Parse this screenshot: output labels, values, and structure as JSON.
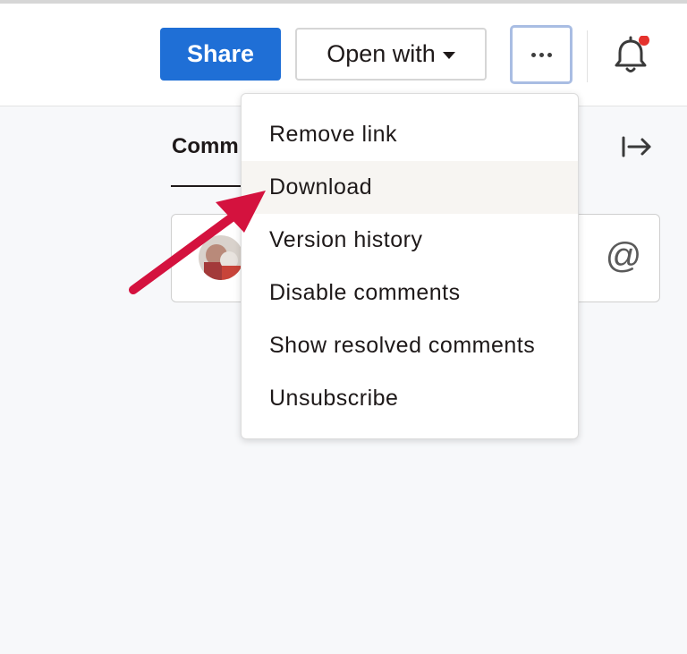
{
  "header": {
    "share_label": "Share",
    "open_with_label": "Open with",
    "notification_dot_color": "#e5322d"
  },
  "sidebar": {
    "comments_tab_label": "Comm"
  },
  "menu": {
    "items": [
      {
        "label": "Remove link"
      },
      {
        "label": "Download"
      },
      {
        "label": "Version history"
      },
      {
        "label": "Disable comments"
      },
      {
        "label": "Show resolved comments"
      },
      {
        "label": "Unsubscribe"
      }
    ]
  },
  "comment": {
    "mention_glyph": "@"
  },
  "colors": {
    "accent": "#1f6fd6",
    "annotation_arrow": "#d4123e",
    "more_button_focus": "#a9bde3"
  }
}
